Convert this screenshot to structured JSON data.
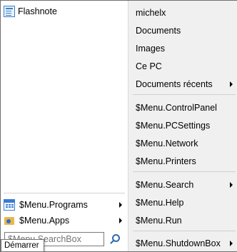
{
  "left": {
    "pinned": [
      {
        "label": "Flashnote",
        "icon": "flashnote-icon"
      }
    ],
    "programs": {
      "label": "$Menu.Programs",
      "icon": "programs-icon"
    },
    "apps": {
      "label": "$Menu.Apps",
      "icon": "apps-icon"
    },
    "search": {
      "placeholder": "$Menu.SearchBox"
    },
    "tooltip": "Démarrer"
  },
  "right": {
    "items": [
      {
        "label": "michelx"
      },
      {
        "label": "Documents"
      },
      {
        "label": "Images"
      },
      {
        "label": "Ce PC"
      },
      {
        "label": "Documents récents",
        "submenu": true
      },
      {
        "label": "$Menu.ControlPanel"
      },
      {
        "label": "$Menu.PCSettings"
      },
      {
        "label": "$Menu.Network"
      },
      {
        "label": "$Menu.Printers"
      },
      {
        "label": "$Menu.Search",
        "submenu": true
      },
      {
        "label": "$Menu.Help"
      },
      {
        "label": "$Menu.Run"
      },
      {
        "label": "$Menu.ShutdownBox",
        "submenu": true
      }
    ]
  }
}
